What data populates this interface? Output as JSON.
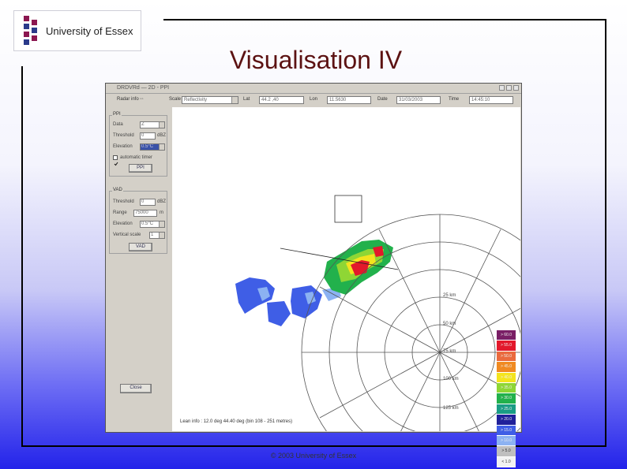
{
  "logo": {
    "text": "University of Essex"
  },
  "slide": {
    "title": "Visualisation IV",
    "footer": "© 2003 University of Essex"
  },
  "app": {
    "window_title": "DRDVRd — 2D - PPI",
    "toolbar": {
      "radar_info": "Radar info  ◦◦",
      "scale_label": "Scale",
      "scale_value": "Reflectivity",
      "lat_label": "Lat",
      "lat_value": "44.2 ,40",
      "lon_label": "Lon",
      "lon_value": "11.5630",
      "date_label": "Date",
      "date_value": "31/03/2003",
      "time_label": "Time",
      "time_value": "14:45:10"
    },
    "ppi": {
      "title": "PPI",
      "data_label": "Data",
      "data_value": "Z",
      "threshold_label": "Threshold",
      "threshold_value": "0",
      "threshold_unit": "dBZ",
      "elevation_label": "Elevation",
      "elevation_value": "0.5°C",
      "checkbox_label": "automatic timer",
      "button": "PPI"
    },
    "vad": {
      "title": "VAD",
      "threshold_label": "Threshold",
      "threshold_value": "0",
      "threshold_unit": "dBZ",
      "range_label": "Range",
      "range_value": "75000",
      "range_unit": "m",
      "elevation_label": "Elevation",
      "elevation_value": "0.5°C",
      "vertical_scale_label": "Vertical scale",
      "vertical_scale_value": "1",
      "button": "VAD"
    },
    "close_button": "Close",
    "ring_labels": [
      "25 km",
      "50 km",
      "75 km",
      "100 km",
      "125 km"
    ],
    "status": "Lean info : 12.0 deg 44.40 deg  (bin 108 - 251 metres)",
    "legend": [
      {
        "label": "> 60.0",
        "color": "#7a1f66"
      },
      {
        "label": "> 55.0",
        "color": "#e3182b"
      },
      {
        "label": "> 50.0",
        "color": "#ea6a3e"
      },
      {
        "label": "> 45.0",
        "color": "#f08a22"
      },
      {
        "label": "> 40.0",
        "color": "#f4e41e"
      },
      {
        "label": "> 35.0",
        "color": "#8fd635"
      },
      {
        "label": "> 30.0",
        "color": "#22b14c"
      },
      {
        "label": "> 25.0",
        "color": "#1a9c85"
      },
      {
        "label": "> 20.0",
        "color": "#20209a"
      },
      {
        "label": "> 15.0",
        "color": "#3f5ee6"
      },
      {
        "label": "> 10.0",
        "color": "#8cb2f2"
      },
      {
        "label": "> 5.0",
        "color": "#bfbfbf"
      },
      {
        "label": "< 1.0",
        "color": "#f2f2f2"
      }
    ]
  }
}
